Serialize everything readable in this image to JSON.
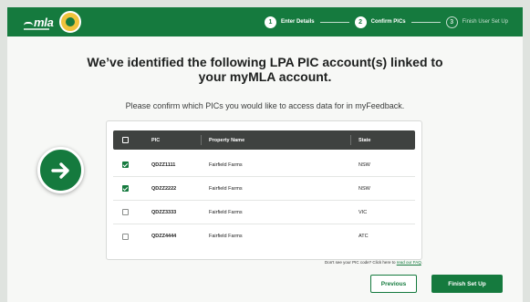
{
  "header": {
    "logo_text": "mla",
    "steps": [
      {
        "number": "1",
        "label": "Enter Details",
        "state": "complete"
      },
      {
        "number": "2",
        "label": "Confirm PICs",
        "state": "active"
      },
      {
        "number": "3",
        "label": "Finish User Set Up",
        "state": "pending"
      }
    ]
  },
  "main": {
    "title_line1": "We’ve identified the following LPA PIC account(s) linked to",
    "title_line2": "your myMLA account.",
    "subtitle": "Please confirm which PICs you would like to access data for in myFeedback."
  },
  "table": {
    "columns": [
      "PIC",
      "Property Name",
      "State"
    ],
    "rows": [
      {
        "pic": "QDZZ1111",
        "property": "Fairfield Farms",
        "state": "NSW",
        "checked": true
      },
      {
        "pic": "QDZZ2222",
        "property": "Fairfield Farms",
        "state": "NSW",
        "checked": true
      },
      {
        "pic": "QDZZ3333",
        "property": "Fairfield Farms",
        "state": "VIC",
        "checked": false
      },
      {
        "pic": "QDZZ4444",
        "property": "Fairfield Farms",
        "state": "ATC",
        "checked": false
      }
    ]
  },
  "footer": {
    "faq_text": "Don't see your PIC code? Click here to",
    "faq_link": "read our FAQ",
    "previous_label": "Previous",
    "finish_label": "Finish Set Up"
  },
  "colors": {
    "brand_green": "#157a3e",
    "header_dark": "#3f4240",
    "badge_yellow": "#f0c33c"
  },
  "icons": {
    "hint": "arrow-right-icon",
    "check": "check-icon"
  }
}
